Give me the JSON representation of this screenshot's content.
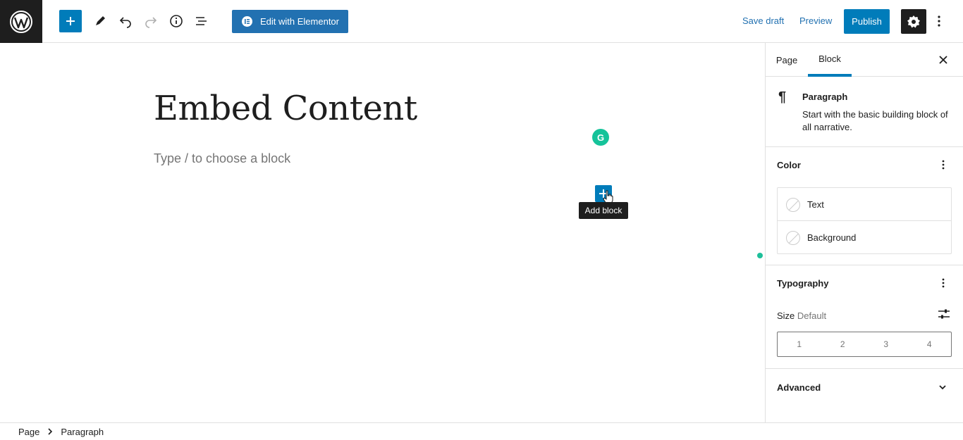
{
  "toolbar": {
    "elementor_label": "Edit with Elementor",
    "save_draft": "Save draft",
    "preview": "Preview",
    "publish": "Publish"
  },
  "editor": {
    "title": "Embed Content",
    "placeholder": "Type / to choose a block",
    "add_block_tooltip": "Add block",
    "grammarly_letter": "G"
  },
  "sidebar": {
    "tabs": [
      {
        "label": "Page",
        "active": false
      },
      {
        "label": "Block",
        "active": true
      }
    ],
    "block": {
      "name": "Paragraph",
      "description": "Start with the basic building block of all narrative."
    },
    "color": {
      "title": "Color",
      "items": [
        "Text",
        "Background"
      ]
    },
    "typography": {
      "title": "Typography",
      "size_label": "Size",
      "size_value": "Default",
      "sizes": [
        "1",
        "2",
        "3",
        "4"
      ]
    },
    "advanced": {
      "title": "Advanced"
    }
  },
  "breadcrumb": [
    "Page",
    "Paragraph"
  ],
  "colors": {
    "accent": "#007cba",
    "dark": "#1e1e1e",
    "grammarly": "#15c39a"
  }
}
